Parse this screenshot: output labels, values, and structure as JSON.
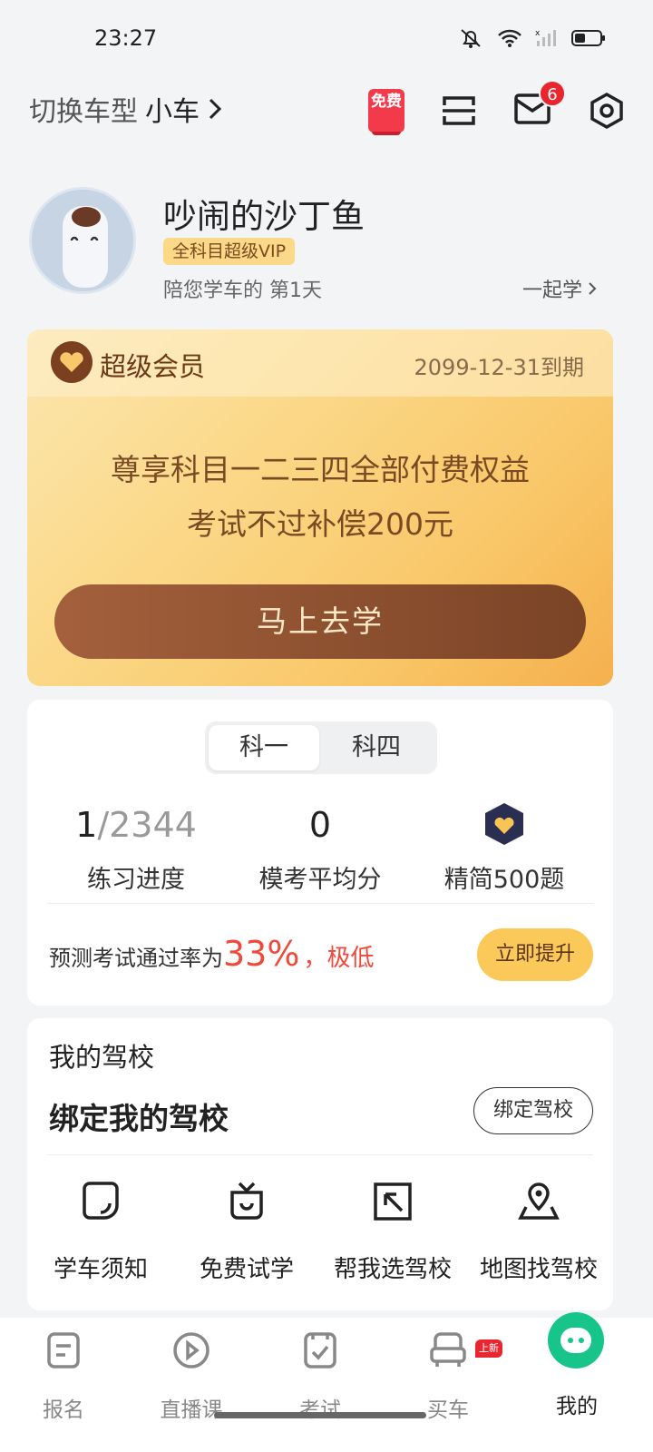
{
  "status_bar": {
    "time": "23:27"
  },
  "header": {
    "switch_label": "切换车型",
    "car_type": "小车",
    "free_badge": "免费",
    "message_count": "6"
  },
  "profile": {
    "nickname": "吵闹的沙丁鱼",
    "vip_tag": "全科目超级VIP",
    "days_text": "陪您学车的 第1天",
    "together_label": "一起学"
  },
  "vip_card": {
    "title": "超级会员",
    "expire": "2099-12-31到期",
    "line1": "尊享科目一二三四全部付费权益",
    "line2": "考试不过补偿200元",
    "button": "马上去学"
  },
  "progress": {
    "tabs": [
      {
        "label": "科一",
        "active": true
      },
      {
        "label": "科四",
        "active": false
      }
    ],
    "practice_done": "1",
    "practice_total": "/2344",
    "practice_label": "练习进度",
    "mock_avg": "0",
    "mock_label": "模考平均分",
    "selected_label": "精简500题",
    "predict_prefix": "预测考试通过率为",
    "predict_pct": "33%",
    "predict_suffix": "，极低",
    "boost_button": "立即提升"
  },
  "school": {
    "title": "我的驾校",
    "bind_title": "绑定我的驾校",
    "bind_button": "绑定驾校",
    "tools": [
      {
        "label": "学车须知",
        "icon": "notice-icon"
      },
      {
        "label": "免费试学",
        "icon": "gift-icon"
      },
      {
        "label": "帮我选驾校",
        "icon": "select-icon"
      },
      {
        "label": "地图找驾校",
        "icon": "map-pin-icon"
      }
    ]
  },
  "nav": {
    "items": [
      {
        "label": "报名",
        "icon": "document-icon"
      },
      {
        "label": "直播课",
        "icon": "play-icon"
      },
      {
        "label": "考试",
        "icon": "exam-icon"
      },
      {
        "label": "买车",
        "icon": "car-icon",
        "tag": "上新"
      },
      {
        "label": "我的",
        "icon": "me-icon",
        "active": true
      }
    ]
  },
  "colors": {
    "accent_red": "#f0493a",
    "vip_gold": "#fbd98a",
    "button_brown": "#8a4e2e",
    "nav_active": "#17c48a"
  }
}
